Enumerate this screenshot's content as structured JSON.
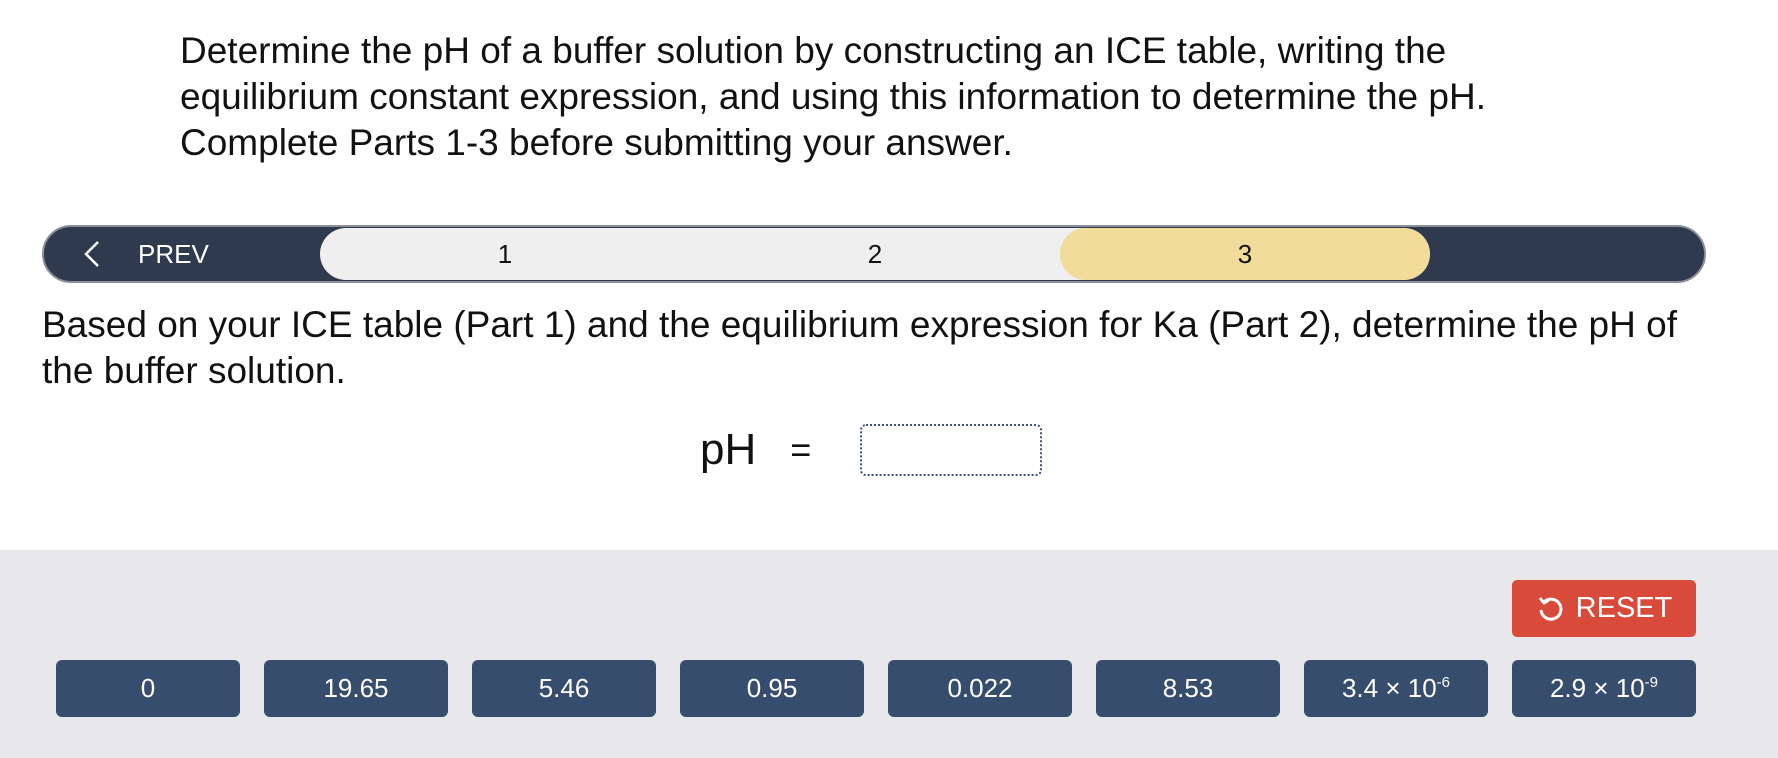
{
  "instructions": "Determine the pH of a buffer solution by constructing an ICE table, writing the equilibrium constant expression, and using this information to determine the pH. Complete Parts 1-3 before submitting your answer.",
  "nav": {
    "prev_label": "PREV",
    "steps": [
      "1",
      "2",
      "3"
    ],
    "active_step": "3"
  },
  "question": "Based on your ICE table (Part 1) and the equilibrium expression for Ka (Part 2), determine the pH of the buffer solution.",
  "equation": {
    "lhs": "pH",
    "sign": "=",
    "answer_value": ""
  },
  "reset_label": "RESET",
  "tiles": [
    {
      "label": "0"
    },
    {
      "label": "19.65"
    },
    {
      "label": "5.46"
    },
    {
      "label": "0.95"
    },
    {
      "label": "0.022"
    },
    {
      "label": "8.53"
    },
    {
      "base": "3.4 × 10",
      "exp": "-6"
    },
    {
      "base": "2.9 × 10",
      "exp": "-9"
    }
  ],
  "colors": {
    "nav_bar": "#2f3a4e",
    "active_step": "#f2dc9b",
    "tile": "#374d6e",
    "reset": "#d84a3a",
    "tray": "#e8e8ec"
  }
}
